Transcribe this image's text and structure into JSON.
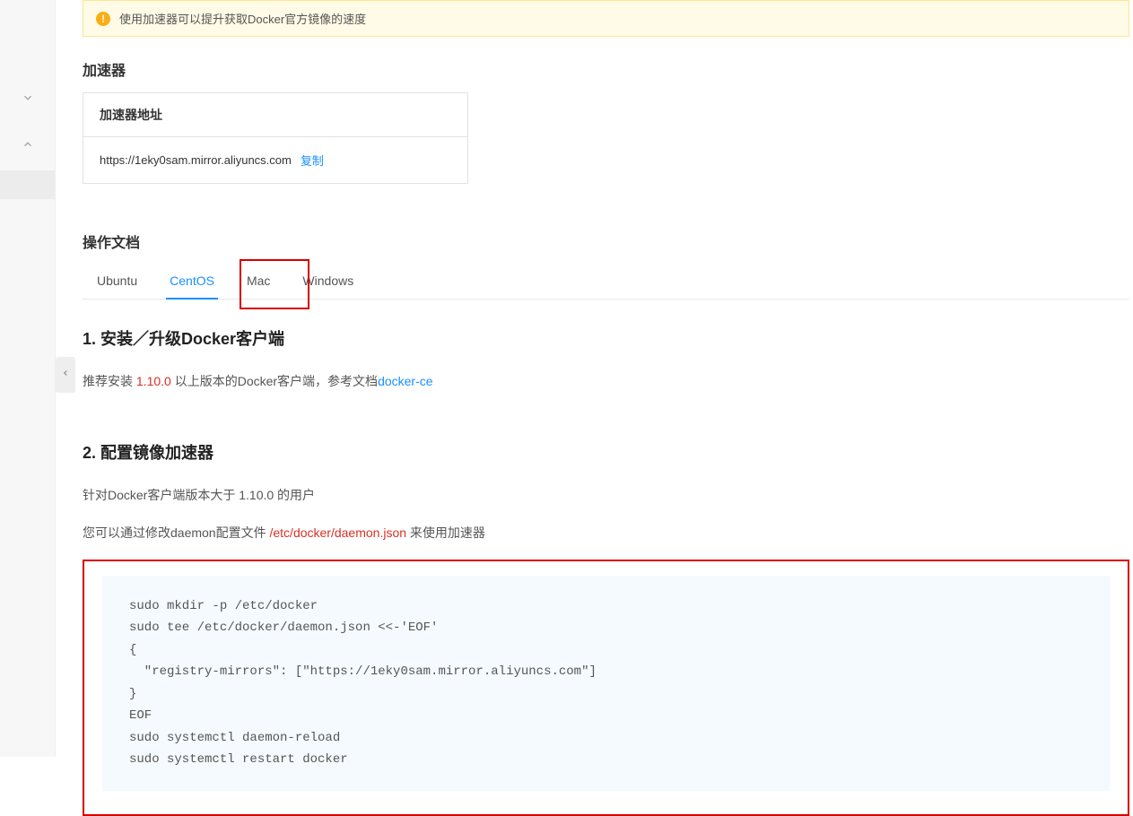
{
  "alert": {
    "message": "使用加速器可以提升获取Docker官方镜像的速度"
  },
  "accelerator": {
    "section_title": "加速器",
    "address_label": "加速器地址",
    "url": "https://1eky0sam.mirror.aliyuncs.com",
    "copy_label": "复制"
  },
  "docs": {
    "section_title": "操作文档",
    "tabs": [
      "Ubuntu",
      "CentOS",
      "Mac",
      "Windows"
    ],
    "active_tab_index": 1,
    "step1": {
      "heading": "1. 安装／升级Docker客户端",
      "desc_prefix": "推荐安装 ",
      "version": "1.10.0",
      "desc_mid": " 以上版本的Docker客户端，参考文档",
      "link_label": "docker-ce"
    },
    "step2": {
      "heading": "2. 配置镜像加速器",
      "line1": "针对Docker客户端版本大于 1.10.0 的用户",
      "line2_prefix": "您可以通过修改daemon配置文件 ",
      "config_path": "/etc/docker/daemon.json",
      "line2_suffix": " 来使用加速器",
      "code": "sudo mkdir -p /etc/docker\nsudo tee /etc/docker/daemon.json <<-'EOF'\n{\n  \"registry-mirrors\": [\"https://1eky0sam.mirror.aliyuncs.com\"]\n}\nEOF\nsudo systemctl daemon-reload\nsudo systemctl restart docker"
    }
  }
}
